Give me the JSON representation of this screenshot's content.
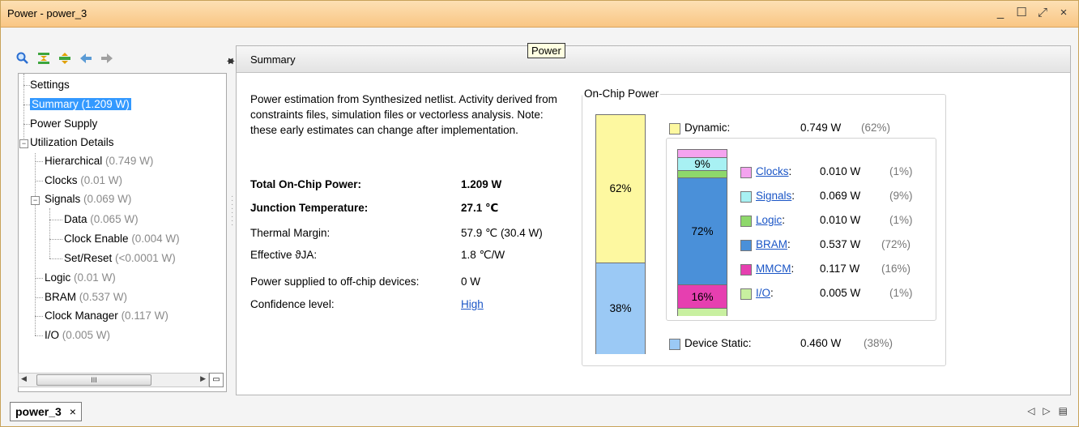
{
  "window": {
    "title": "Power - power_3",
    "controls": [
      "_",
      "☐",
      "⤢",
      "×"
    ]
  },
  "toolbar": {
    "icons": [
      "search-icon",
      "collapse-all-icon",
      "expand-all-icon",
      "back-icon",
      "forward-icon"
    ]
  },
  "tree": {
    "settings": "Settings",
    "summary": "Summary (1.209 W)",
    "power_supply": "Power Supply",
    "utilization": "Utilization Details",
    "hier": {
      "label": "Hierarchical",
      "value": "(0.749 W)"
    },
    "clocks": {
      "label": "Clocks",
      "value": "(0.01 W)"
    },
    "signals": {
      "label": "Signals",
      "value": "(0.069 W)"
    },
    "data": {
      "label": "Data",
      "value": "(0.065 W)"
    },
    "clock_enable": {
      "label": "Clock Enable",
      "value": "(0.004 W)"
    },
    "set_reset": {
      "label": "Set/Reset",
      "value": "(<0.0001 W)"
    },
    "logic": {
      "label": "Logic",
      "value": "(0.01 W)"
    },
    "bram": {
      "label": "BRAM",
      "value": "(0.537 W)"
    },
    "clock_manager": {
      "label": "Clock Manager",
      "value": "(0.117 W)"
    },
    "io": {
      "label": "I/O",
      "value": "(0.005 W)"
    }
  },
  "content": {
    "header": "Summary",
    "tooltip": "Power",
    "description": "Power estimation from Synthesized netlist. Activity derived from constraints files, simulation files or vectorless analysis. Note: these early estimates can change after implementation.",
    "rows": [
      {
        "label": "Total On-Chip Power:",
        "value": "1.209 W"
      },
      {
        "label": "Junction Temperature:",
        "value": "27.1 ℃"
      },
      {
        "label": "Thermal Margin:",
        "value": "57.9 ℃ (30.4 W)"
      },
      {
        "label": "Effective ϑJA:",
        "value": "1.8 ℃/W"
      },
      {
        "label": "Power supplied to off-chip devices:",
        "value": "0 W"
      },
      {
        "label": "Confidence level:",
        "value": "High"
      }
    ]
  },
  "on_chip": {
    "title": "On-Chip Power",
    "dynamic": {
      "label": "Dynamic:",
      "value": "0.749 W",
      "pct": "(62%)",
      "bar_pct": "62%",
      "fraction": 0.62,
      "color": "#fdf8a0"
    },
    "static": {
      "label": "Device Static:",
      "value": "0.460 W",
      "pct": "(38%)",
      "bar_pct": "38%",
      "fraction": 0.38,
      "color": "#9bc9f5"
    },
    "breakdown": [
      {
        "label": "Clocks:",
        "value": "0.010 W",
        "pct": "(1%)",
        "color": "#f4a3ef",
        "fraction": 0.01,
        "link": true
      },
      {
        "label": "Signals:",
        "value": "0.069 W",
        "pct": "(9%)",
        "color": "#a8f1f3",
        "fraction": 0.09,
        "link": true
      },
      {
        "label": "Logic:",
        "value": "0.010 W",
        "pct": "(1%)",
        "color": "#8ed86b",
        "fraction": 0.01,
        "link": true
      },
      {
        "label": "BRAM:",
        "value": "0.537 W",
        "pct": "(72%)",
        "color": "#4a90d9",
        "fraction": 0.72,
        "link": true
      },
      {
        "label": "MMCM:",
        "value": "0.117 W",
        "pct": "(16%)",
        "color": "#e63fb0",
        "fraction": 0.16,
        "link": true
      },
      {
        "label": "I/O:",
        "value": "0.005 W",
        "pct": "(1%)",
        "color": "#c8f0a0",
        "fraction": 0.01,
        "link": true
      }
    ],
    "sub_bar_labels": {
      "signals": "9%",
      "bram": "72%",
      "mmcm": "16%"
    }
  },
  "bottom": {
    "tab": "power_3",
    "tab_close": "×"
  }
}
